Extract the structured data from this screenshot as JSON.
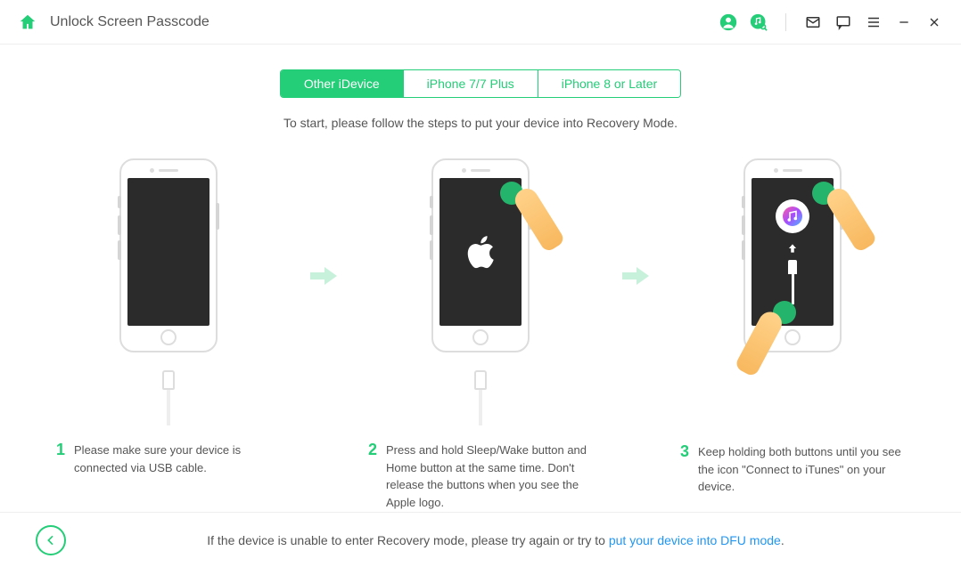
{
  "header": {
    "title": "Unlock Screen Passcode"
  },
  "tabs": [
    {
      "label": "Other iDevice",
      "active": true
    },
    {
      "label": "iPhone 7/7 Plus",
      "active": false
    },
    {
      "label": "iPhone 8 or Later",
      "active": false
    }
  ],
  "instruction": "To start, please follow the steps to put your device into Recovery Mode.",
  "steps": [
    {
      "num": "1",
      "text": "Please make sure your device is connected via USB cable."
    },
    {
      "num": "2",
      "text": "Press and hold Sleep/Wake button and Home button at the same time. Don't release the buttons when you see the Apple logo."
    },
    {
      "num": "3",
      "text": "Keep holding both buttons until you see the icon \"Connect to iTunes\" on your device."
    }
  ],
  "footer": {
    "prefix": "If the device is unable to enter Recovery mode, please try again or try to ",
    "link": "put your device into DFU mode",
    "suffix": "."
  },
  "colors": {
    "accent": "#24cd77"
  }
}
